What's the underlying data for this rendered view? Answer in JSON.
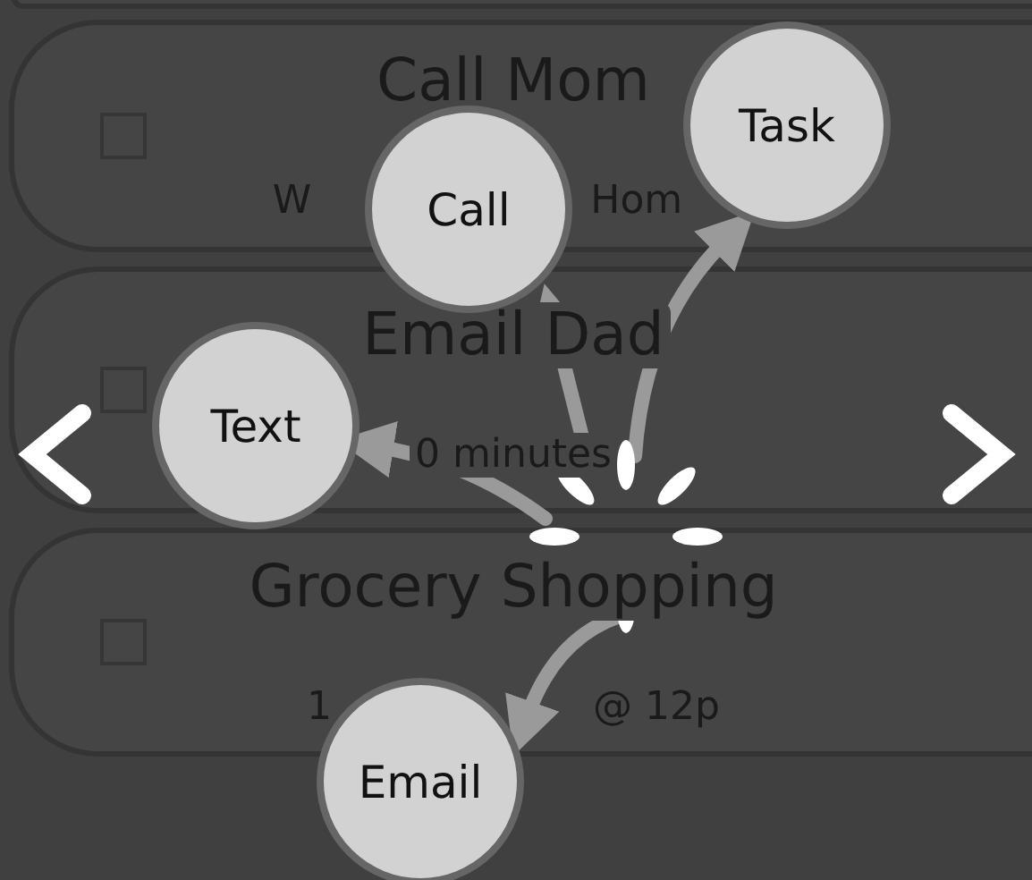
{
  "rows": [
    {
      "title": "Call Mom",
      "subtitle_parts": [
        "W",
        "Hom"
      ],
      "checked": false
    },
    {
      "title": "Email Dad",
      "subtitle_parts": [
        "0 minutes"
      ],
      "checked": false
    },
    {
      "title": "Grocery Shopping",
      "subtitle_parts": [
        "1",
        "@ 12p"
      ],
      "checked": false
    }
  ],
  "menu_options": [
    {
      "label": "Call"
    },
    {
      "label": "Task"
    },
    {
      "label": "Text"
    },
    {
      "label": "Email"
    }
  ]
}
